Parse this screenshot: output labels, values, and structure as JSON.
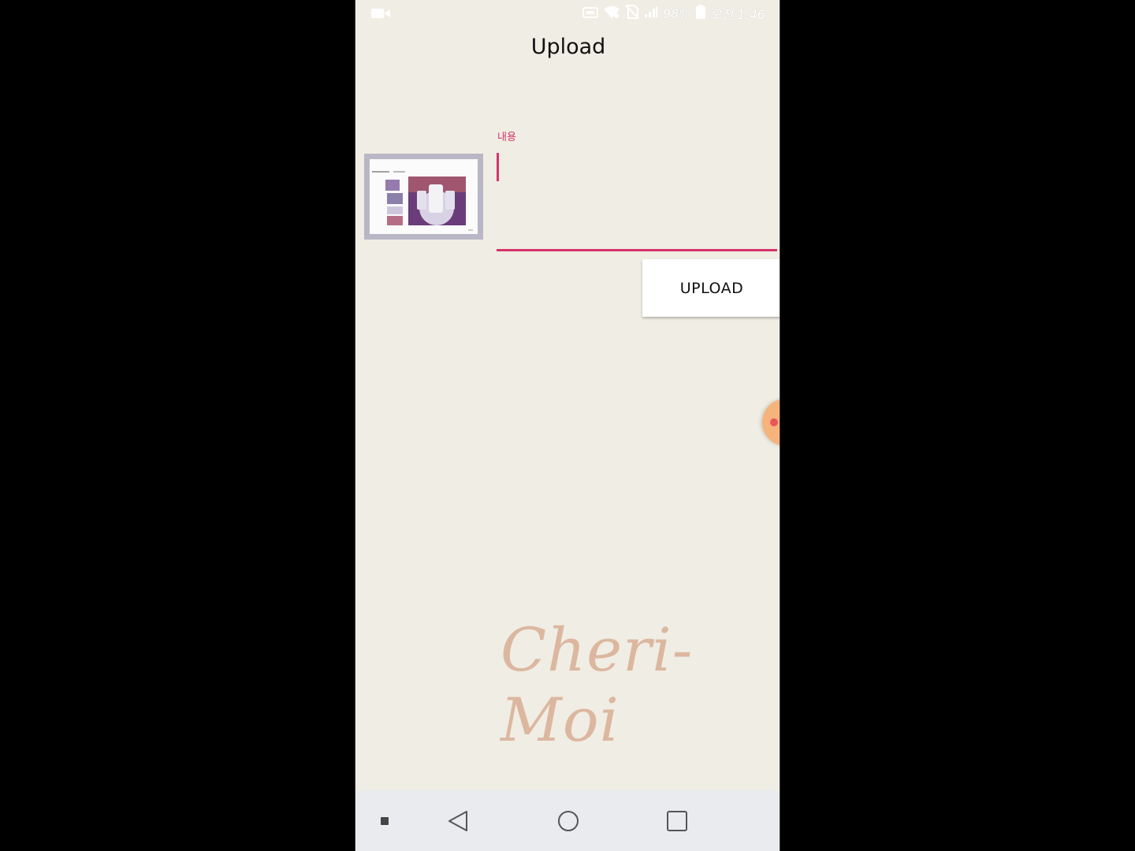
{
  "status_bar": {
    "battery_percent": "98%",
    "time": "오전 1:46",
    "icons": [
      "video-recording-icon",
      "nfc-icon",
      "wifi-icon",
      "no-sim-icon",
      "signal-icon",
      "battery-icon"
    ]
  },
  "screen": {
    "title": "Upload"
  },
  "content_field": {
    "label": "내용",
    "value": ""
  },
  "actions": {
    "upload_label": "UPLOAD"
  },
  "watermark": {
    "text": "Cheri-Moi"
  },
  "navigation": {
    "items": [
      "menu-dot-icon",
      "back-icon",
      "home-icon",
      "recents-icon"
    ]
  },
  "colors": {
    "background": "#f0ede4",
    "accent": "#d6336c",
    "watermark": "#dcb7a0",
    "float_handle": "#f6b37c"
  }
}
